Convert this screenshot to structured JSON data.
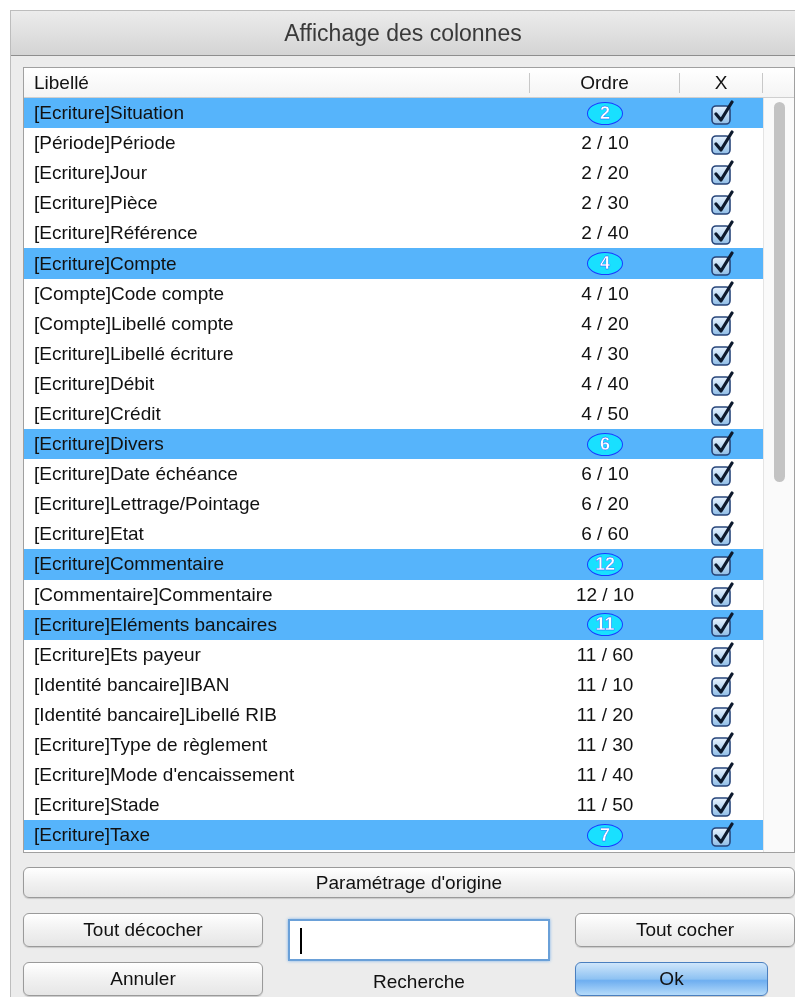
{
  "window": {
    "title": "Affichage des colonnes"
  },
  "table": {
    "columns": [
      "Libellé",
      "Ordre",
      "X"
    ],
    "rows": [
      {
        "label": "[Ecriture]Situation",
        "order": "2",
        "kind": "group",
        "checked": true
      },
      {
        "label": "[Période]Période",
        "order": "2 / 10",
        "kind": "item",
        "checked": true
      },
      {
        "label": "[Ecriture]Jour",
        "order": "2 / 20",
        "kind": "item",
        "checked": true
      },
      {
        "label": "[Ecriture]Pièce",
        "order": "2 / 30",
        "kind": "item",
        "checked": true
      },
      {
        "label": "[Ecriture]Référence",
        "order": "2 / 40",
        "kind": "item",
        "checked": true
      },
      {
        "label": "[Ecriture]Compte",
        "order": "4",
        "kind": "group",
        "checked": true
      },
      {
        "label": "[Compte]Code compte",
        "order": "4 / 10",
        "kind": "item",
        "checked": true
      },
      {
        "label": "[Compte]Libellé compte",
        "order": "4 / 20",
        "kind": "item",
        "checked": true
      },
      {
        "label": "[Ecriture]Libellé écriture",
        "order": "4 / 30",
        "kind": "item",
        "checked": true
      },
      {
        "label": "[Ecriture]Débit",
        "order": "4 / 40",
        "kind": "item",
        "checked": true
      },
      {
        "label": "[Ecriture]Crédit",
        "order": "4 / 50",
        "kind": "item",
        "checked": true
      },
      {
        "label": "[Ecriture]Divers",
        "order": "6",
        "kind": "group",
        "checked": true
      },
      {
        "label": "[Ecriture]Date échéance",
        "order": "6 / 10",
        "kind": "item",
        "checked": true
      },
      {
        "label": "[Ecriture]Lettrage/Pointage",
        "order": "6 / 20",
        "kind": "item",
        "checked": true
      },
      {
        "label": "[Ecriture]Etat",
        "order": "6 / 60",
        "kind": "item",
        "checked": true
      },
      {
        "label": "[Ecriture]Commentaire",
        "order": "12",
        "kind": "group",
        "checked": true
      },
      {
        "label": "[Commentaire]Commentaire",
        "order": "12 / 10",
        "kind": "item",
        "checked": true
      },
      {
        "label": "[Ecriture]Eléments bancaires",
        "order": "11",
        "kind": "group",
        "checked": true
      },
      {
        "label": "[Ecriture]Ets payeur",
        "order": "11 / 60",
        "kind": "item",
        "checked": true
      },
      {
        "label": "[Identité bancaire]IBAN",
        "order": "11 / 10",
        "kind": "item",
        "checked": true
      },
      {
        "label": "[Identité bancaire]Libellé RIB",
        "order": "11 / 20",
        "kind": "item",
        "checked": true
      },
      {
        "label": "[Ecriture]Type de règlement",
        "order": "11 / 30",
        "kind": "item",
        "checked": true
      },
      {
        "label": "[Ecriture]Mode d'encaissement",
        "order": "11 / 40",
        "kind": "item",
        "checked": true
      },
      {
        "label": "[Ecriture]Stade",
        "order": "11 / 50",
        "kind": "item",
        "checked": true
      },
      {
        "label": "[Ecriture]Taxe",
        "order": "7",
        "kind": "group",
        "checked": true
      }
    ]
  },
  "reset_button": "Paramétrage d'origine",
  "uncheck_all_button": "Tout décocher",
  "check_all_button": "Tout cocher",
  "cancel_button": "Annuler",
  "ok_button": "Ok",
  "search": {
    "label": "Recherche"
  }
}
